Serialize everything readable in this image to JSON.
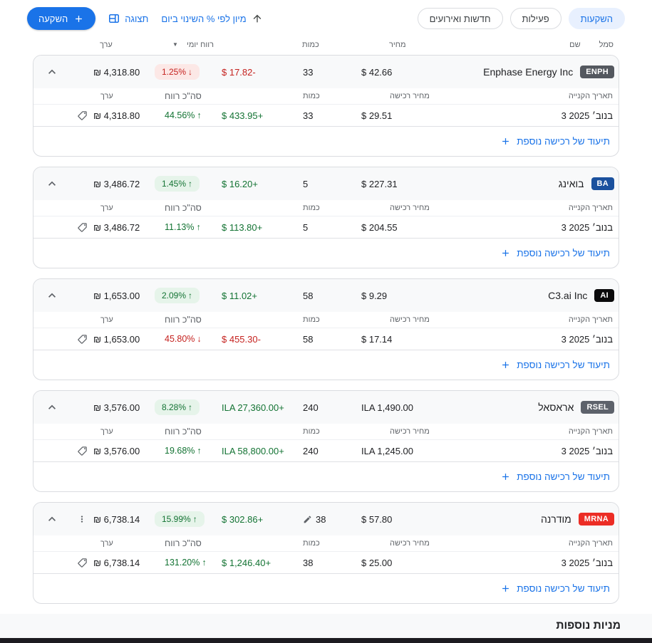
{
  "toolbar": {
    "add_investment": "השקעה",
    "view": "תצוגה",
    "sort": "מיון לפי % השינוי ביום"
  },
  "tabs": [
    {
      "label": "השקעות",
      "active": true
    },
    {
      "label": "פעילות",
      "active": false
    },
    {
      "label": "חדשות ואירועים",
      "active": false
    }
  ],
  "columns": {
    "value": "ערך",
    "daily_profit": "רווח יומי",
    "qty": "כמות",
    "price": "מחיר",
    "name": "שם",
    "symbol": "סמל"
  },
  "sub_columns": {
    "value": "ערך",
    "total_profit": "סה\"כ רווח",
    "qty": "כמות",
    "purchase_price": "מחיר רכישה",
    "purchase_date": "תאריך הקנייה"
  },
  "add_purchase_label": "תיעוד של רכישה נוספת",
  "icons": {
    "arrow_up": "↑",
    "arrow_down": "↓"
  },
  "cards": [
    {
      "symbol": "ENPH",
      "symbol_bg": "#54585f",
      "name": "Enphase Energy Inc",
      "price": "$ 42.66",
      "qty": "33",
      "daily_change": "$ 17.82-",
      "daily_change_dir": "down",
      "daily_pct": "1.25%",
      "daily_pct_dir": "down",
      "value": "₪ 4,318.80",
      "purchase_date": "3 בנוב׳ 2025",
      "purchase_price": "$ 29.51",
      "purchase_qty": "33",
      "total_change": "$ 433.95+",
      "total_change_dir": "up",
      "total_pct": "44.56%",
      "total_pct_dir": "up",
      "total_value": "₪ 4,318.80",
      "has_kebab": false,
      "has_pencil": false
    },
    {
      "symbol": "BA",
      "symbol_bg": "#1b519e",
      "name": "בואינג",
      "price": "$ 227.31",
      "qty": "5",
      "daily_change": "$ 16.20+",
      "daily_change_dir": "up",
      "daily_pct": "1.45%",
      "daily_pct_dir": "up",
      "value": "₪ 3,486.72",
      "purchase_date": "3 בנוב׳ 2025",
      "purchase_price": "$ 204.55",
      "purchase_qty": "5",
      "total_change": "$ 113.80+",
      "total_change_dir": "up",
      "total_pct": "11.13%",
      "total_pct_dir": "up",
      "total_value": "₪ 3,486.72",
      "has_kebab": false,
      "has_pencil": false
    },
    {
      "symbol": "AI",
      "symbol_bg": "#0b0b0c",
      "name": "C3.ai Inc",
      "price": "$ 9.29",
      "qty": "58",
      "daily_change": "$ 11.02+",
      "daily_change_dir": "up",
      "daily_pct": "2.09%",
      "daily_pct_dir": "up",
      "value": "₪ 1,653.00",
      "purchase_date": "3 בנוב׳ 2025",
      "purchase_price": "$ 17.14",
      "purchase_qty": "58",
      "total_change": "$ 455.30-",
      "total_change_dir": "down",
      "total_pct": "45.80%",
      "total_pct_dir": "down",
      "total_value": "₪ 1,653.00",
      "has_kebab": false,
      "has_pencil": false
    },
    {
      "symbol": "RSEL",
      "symbol_bg": "#5d626b",
      "name": "אראסאל",
      "price": "ILA 1,490.00",
      "qty": "240",
      "daily_change": "ILA 27,360.00+",
      "daily_change_dir": "up",
      "daily_pct": "8.28%",
      "daily_pct_dir": "up",
      "value": "₪ 3,576.00",
      "purchase_date": "3 בנוב׳ 2025",
      "purchase_price": "ILA 1,245.00",
      "purchase_qty": "240",
      "total_change": "ILA 58,800.00+",
      "total_change_dir": "up",
      "total_pct": "19.68%",
      "total_pct_dir": "up",
      "total_value": "₪ 3,576.00",
      "has_kebab": false,
      "has_pencil": false
    },
    {
      "symbol": "MRNA",
      "symbol_bg": "#ec2d25",
      "name": "מודרנה",
      "price": "$ 57.80",
      "qty": "38",
      "daily_change": "$ 302.86+",
      "daily_change_dir": "up",
      "daily_pct": "15.99%",
      "daily_pct_dir": "up",
      "value": "₪ 6,738.14",
      "purchase_date": "3 בנוב׳ 2025",
      "purchase_price": "$ 25.00",
      "purchase_qty": "38",
      "total_change": "$ 1,246.40+",
      "total_change_dir": "up",
      "total_pct": "131.20%",
      "total_pct_dir": "up",
      "total_value": "₪ 6,738.14",
      "has_kebab": true,
      "has_pencil": true
    }
  ],
  "footer": {
    "more_stocks": "מניות נוספות"
  },
  "colors": {
    "accent": "#1a73e8",
    "positive": "#137333",
    "negative": "#c5221f",
    "positive_bg": "#e6f4ea",
    "negative_bg": "#fce8e6"
  }
}
